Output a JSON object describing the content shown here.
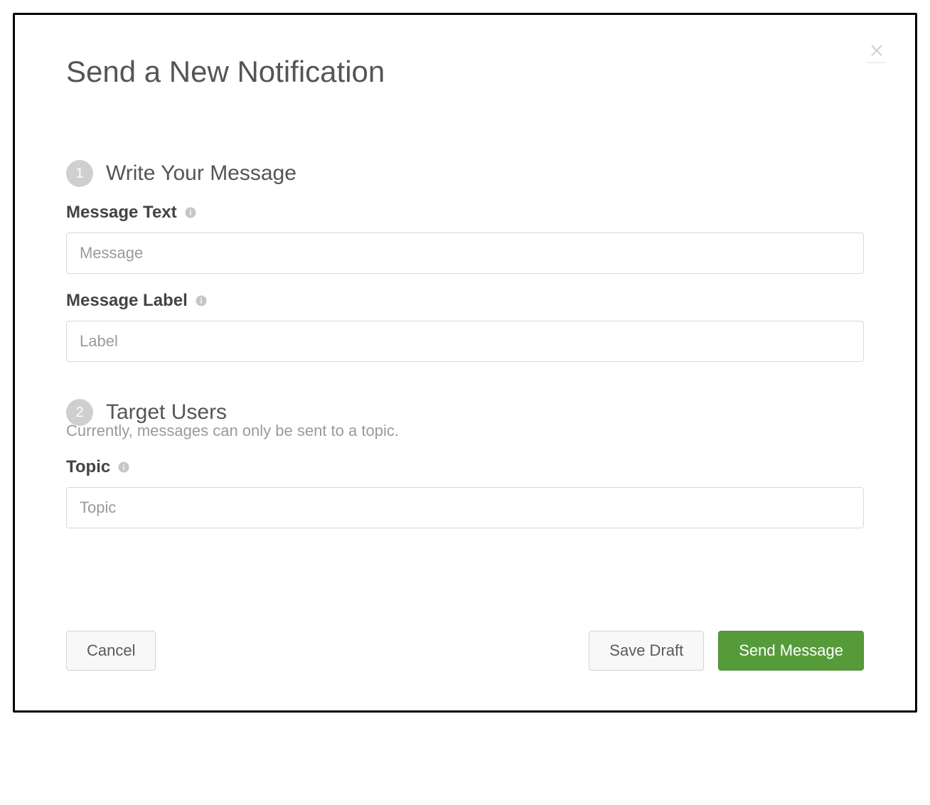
{
  "dialog": {
    "title": "Send a New Notification"
  },
  "step1": {
    "number": "1",
    "title": "Write Your Message",
    "messageText": {
      "label": "Message Text",
      "placeholder": "Message",
      "value": ""
    },
    "messageLabel": {
      "label": "Message Label",
      "placeholder": "Label",
      "value": ""
    }
  },
  "step2": {
    "number": "2",
    "title": "Target Users",
    "subtitle": "Currently, messages can only be sent to a topic.",
    "topic": {
      "label": "Topic",
      "placeholder": "Topic",
      "value": ""
    }
  },
  "footer": {
    "cancel": "Cancel",
    "saveDraft": "Save Draft",
    "sendMessage": "Send Message"
  }
}
